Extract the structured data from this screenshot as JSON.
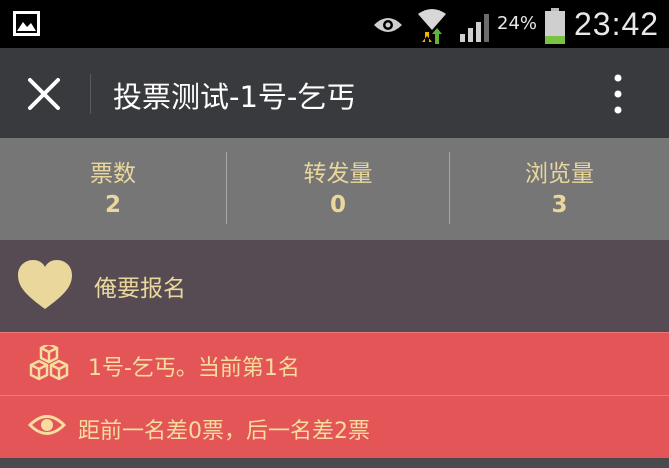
{
  "status_bar": {
    "battery_text": "24%",
    "battery_level": 0.24,
    "time": "23:42",
    "icons": [
      "gallery-icon",
      "eye-icon",
      "wifi-icon",
      "signal-icon",
      "battery-icon"
    ]
  },
  "title_bar": {
    "title": "投票测试-1号-乞丐",
    "icons": [
      "close-icon",
      "more-vertical-icon"
    ]
  },
  "stats": [
    {
      "label": "票数",
      "value": "2"
    },
    {
      "label": "转发量",
      "value": "0"
    },
    {
      "label": "浏览量",
      "value": "3"
    }
  ],
  "signup": {
    "label": "俺要报名",
    "icon": "heart-icon"
  },
  "rank": {
    "text": "1号-乞丐。当前第1名",
    "icon": "boxes-icon"
  },
  "gap": {
    "text": "距前一名差0票，后一名差2票",
    "icon": "eye-icon"
  },
  "colors": {
    "accent_gold": "#e9d79c",
    "red_row": "#e35556",
    "title_bar": "#393a3e",
    "stats_bar": "#767676",
    "signup_bar": "#564b52"
  }
}
